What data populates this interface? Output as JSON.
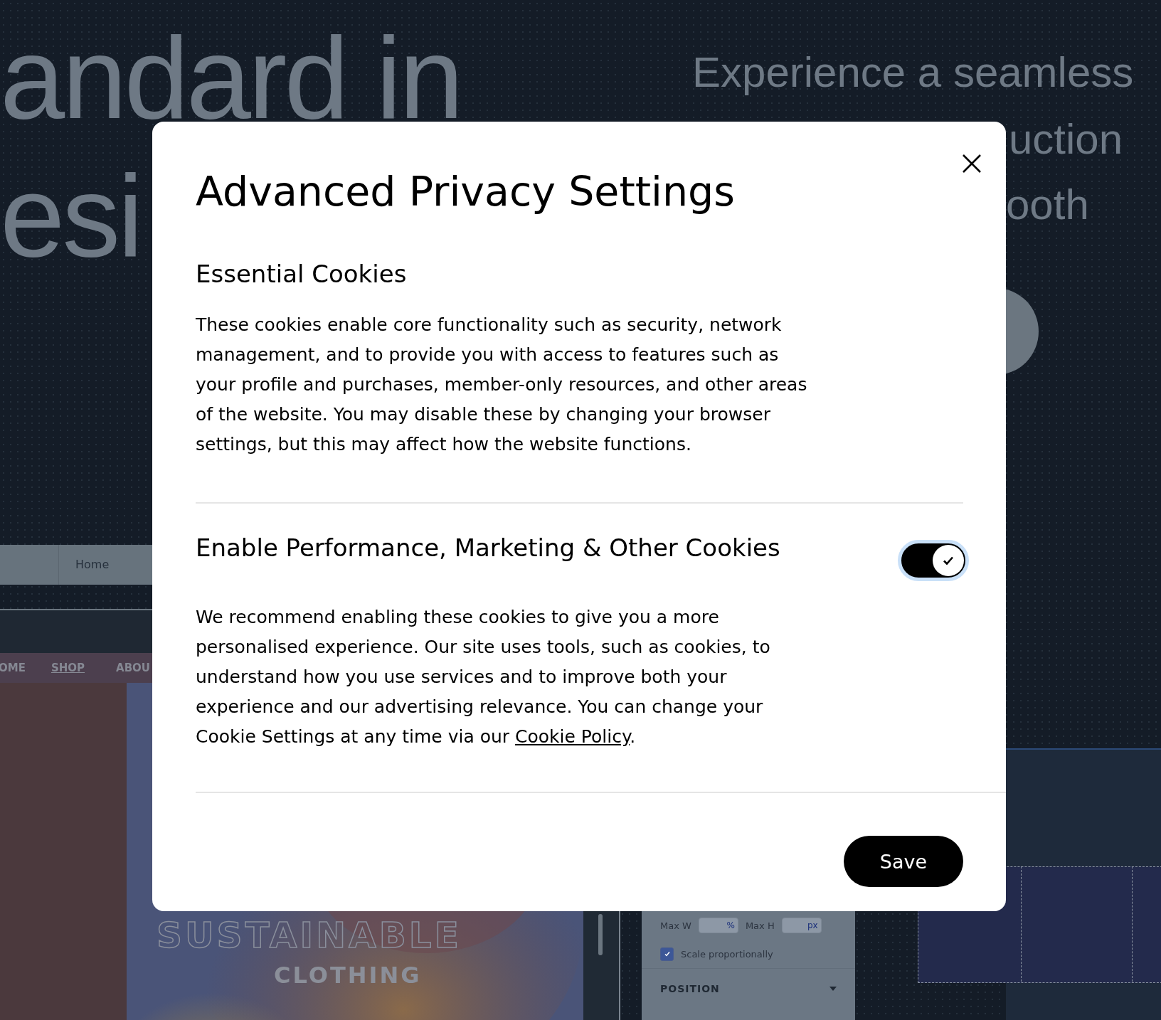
{
  "background": {
    "headline_lines": [
      "andard in",
      "esi"
    ],
    "subtitle_lines": [
      "Experience a seamless",
      "uction",
      "ooth"
    ],
    "editor_nav": [
      {
        "label": "Home"
      }
    ],
    "site_nav": [
      {
        "label": "OME",
        "selected": false
      },
      {
        "label": "SHOP",
        "selected": true
      },
      {
        "label": "ABOU",
        "selected": false
      }
    ],
    "hero_title": "SUSTAINABLE",
    "hero_subtitle": "CLOTHING",
    "inspector": {
      "fields": [
        {
          "label": "Max W",
          "unit": "%"
        },
        {
          "label": "Max H",
          "unit": "px"
        }
      ],
      "checkbox": {
        "label": "Scale proportionally",
        "checked": true
      },
      "section": "POSITION"
    }
  },
  "dialog": {
    "title": "Advanced Privacy Settings",
    "sections": [
      {
        "title": "Essential Cookies",
        "text": "These cookies enable core functionality such as security, network management, and to provide you with access to features such as your profile and purchases, member-only resources, and other areas of the website. You may disable these by changing your browser settings, but this may affect how the website functions."
      },
      {
        "title": "Enable Performance, Marketing & Other Cookies",
        "toggle": {
          "on": true
        },
        "text": "We recommend enabling these cookies to give you a more personalised experience. Our site uses tools, such as cookies, to understand how you use services and to improve both your experience and our advertising relevance. You can change your Cookie Settings at any time via our ",
        "link": "Cookie Policy",
        "text_after": "."
      }
    ],
    "save_button": "Save"
  }
}
